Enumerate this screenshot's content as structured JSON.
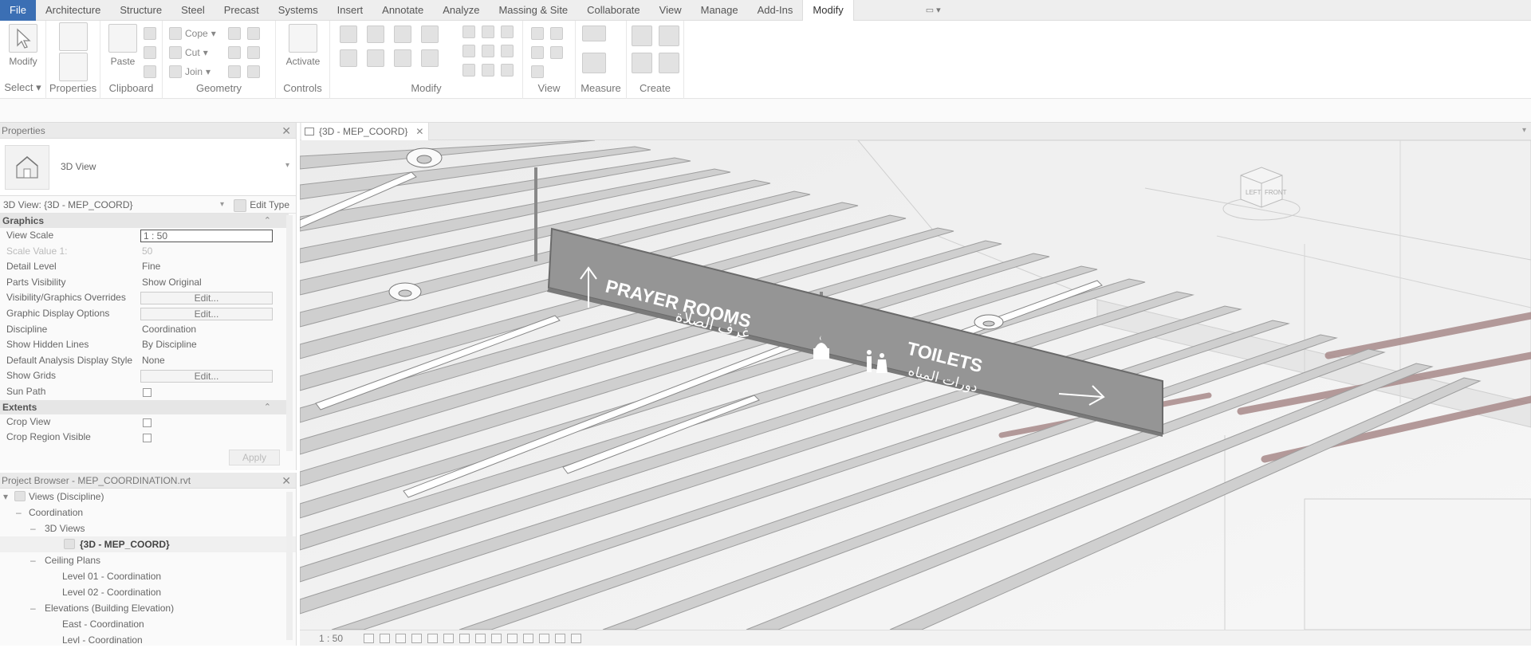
{
  "ribbon": {
    "tabs": [
      "File",
      "Architecture",
      "Structure",
      "Steel",
      "Precast",
      "Systems",
      "Insert",
      "Annotate",
      "Analyze",
      "Massing & Site",
      "Collaborate",
      "View",
      "Manage",
      "Add-Ins",
      "Modify"
    ],
    "active_tab": "Modify",
    "modify_button": "Modify",
    "select_label": "Select",
    "panels": {
      "properties": "Properties",
      "clipboard": "Clipboard",
      "geometry": "Geometry",
      "controls": "Controls",
      "modify": "Modify",
      "view": "View",
      "measure": "Measure",
      "create": "Create"
    },
    "paste": "Paste",
    "cope": "Cope",
    "cut": "Cut",
    "join": "Join",
    "activate": "Activate"
  },
  "properties": {
    "title": "Properties",
    "type_name": "3D View",
    "instance": "3D View: {3D - MEP_COORD}",
    "edit_type": "Edit Type",
    "groups": {
      "graphics": "Graphics",
      "extents": "Extents"
    },
    "rows": {
      "view_scale": {
        "label": "View Scale",
        "value": "1 : 50"
      },
      "scale_value": {
        "label": "Scale Value   1:",
        "value": "50"
      },
      "detail_level": {
        "label": "Detail Level",
        "value": "Fine"
      },
      "parts_visibility": {
        "label": "Parts Visibility",
        "value": "Show Original"
      },
      "vg_overrides": {
        "label": "Visibility/Graphics Overrides",
        "value": "Edit..."
      },
      "graphic_display": {
        "label": "Graphic Display Options",
        "value": "Edit..."
      },
      "discipline": {
        "label": "Discipline",
        "value": "Coordination"
      },
      "hidden_lines": {
        "label": "Show Hidden Lines",
        "value": "By Discipline"
      },
      "analysis_style": {
        "label": "Default Analysis Display Style",
        "value": "None"
      },
      "show_grids": {
        "label": "Show Grids",
        "value": "Edit..."
      },
      "sun_path": {
        "label": "Sun Path"
      },
      "crop_view": {
        "label": "Crop View"
      },
      "crop_region": {
        "label": "Crop Region Visible"
      }
    },
    "apply": "Apply"
  },
  "browser": {
    "title": "Project Browser - MEP_COORDINATION.rvt",
    "items": [
      {
        "label": "Views (Discipline)"
      },
      {
        "label": "Coordination"
      },
      {
        "label": "3D Views"
      },
      {
        "label": "{3D - MEP_COORD}"
      },
      {
        "label": "Ceiling Plans"
      },
      {
        "label": "Level 01 - Coordination"
      },
      {
        "label": "Level 02 - Coordination"
      },
      {
        "label": "Elevations (Building Elevation)"
      },
      {
        "label": "East - Coordination"
      },
      {
        "label": "Levl - Coordination"
      }
    ]
  },
  "view": {
    "tab_title": "{3D - MEP_COORD}",
    "scale": "1 : 50",
    "viewcube": {
      "left": "LEFT",
      "front": "FRONT"
    },
    "sign": {
      "prayer_en": "PRAYER ROOMS",
      "prayer_ar": "غرف الصلاة",
      "toilets_en": "TOILETS",
      "toilets_ar": "دورات المياه"
    }
  },
  "colors": {
    "file_tab": "#3b6fb4",
    "sign_panel": "#8f8f8f",
    "pipe": "#a88a8a"
  }
}
